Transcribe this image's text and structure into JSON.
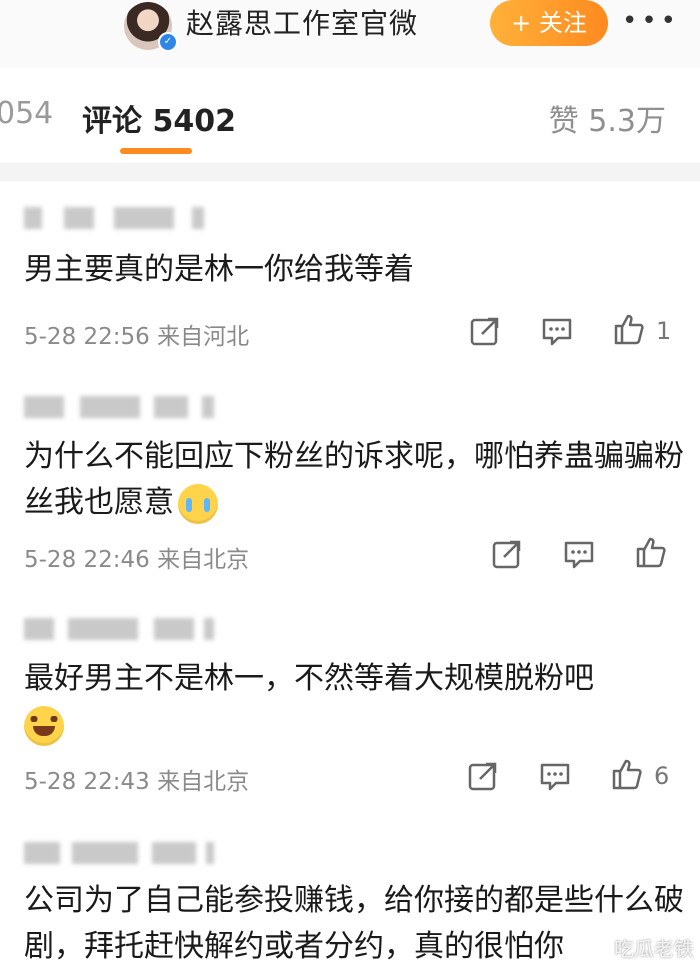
{
  "header": {
    "account_name": "赵露思工作室官微",
    "follow_label": "+ 关注",
    "more_label": "•••"
  },
  "tabs": {
    "repost_label": "054",
    "comment_label": "评论 5402",
    "like_label": "赞 5.3万"
  },
  "comments": [
    {
      "text": "男主要真的是林一你给我等着",
      "time_location": "5-28 22:56 来自河北",
      "likes": "1",
      "emoji": ""
    },
    {
      "text": "为什么不能回应下粉丝的诉求呢，哪怕养蛊骗骗粉丝我也愿意",
      "time_location": "5-28 22:46 来自北京",
      "likes": "",
      "emoji": "crying-face"
    },
    {
      "text": "最好男主不是林一，不然等着大规模脱粉吧",
      "time_location": "5-28 22:43 来自北京",
      "likes": "6",
      "emoji": "smiling-face"
    },
    {
      "text": "公司为了自己能参投赚钱，给你接的都是些什么破剧，拜托赶快解约或者分约，真的很怕你",
      "time_location": "",
      "likes": "",
      "emoji": ""
    }
  ],
  "icons": {
    "share": "share-icon",
    "comment": "comment-icon",
    "like": "thumbs-up-icon"
  },
  "watermark": "吃瓜老铁",
  "colors": {
    "accent": "#ff8a1f",
    "verified": "#2f86e8"
  }
}
